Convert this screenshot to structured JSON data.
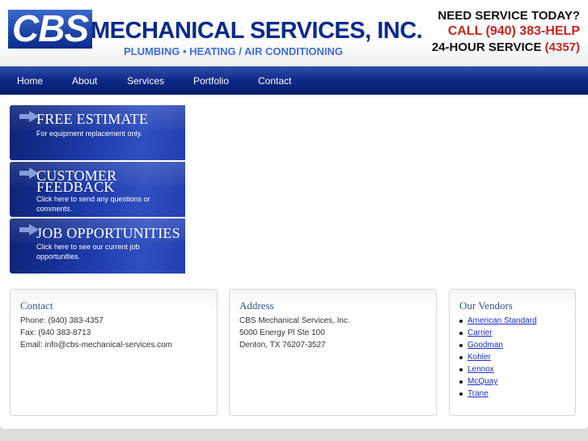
{
  "header": {
    "logo_cbs": "CBS",
    "logo_name": "MECHANICAL SERVICES, INC.",
    "tagline": "PLUMBING • HEATING / AIR CONDITIONING",
    "service_line1": "NEED SERVICE TODAY?",
    "service_line2": "CALL (940) 383-HELP",
    "service_line3": "24-HOUR SERVICE",
    "service_line3_number": "(4357)"
  },
  "nav": {
    "items": [
      {
        "label": "Home"
      },
      {
        "label": "About"
      },
      {
        "label": "Services"
      },
      {
        "label": "Portfolio"
      },
      {
        "label": "Contact"
      }
    ]
  },
  "promos": [
    {
      "title": "FREE ESTIMATE",
      "text": "For equipment replacement only."
    },
    {
      "title": "CUSTOMER FEEDBACK",
      "text": "Click here to send any questions or comments."
    },
    {
      "title": "JOB OPPORTUNITIES",
      "text": "Click here to see our current job opportunities."
    }
  ],
  "contact": {
    "title": "Contact",
    "phone": "Phone: (940) 383-4357",
    "fax": "Fax: (940 383-8713",
    "email": "Email: info@cbs-mechanical-services.com"
  },
  "address": {
    "title": "Address",
    "line1": "CBS Mechanical Services, Inc.",
    "line2": "5000 Energy Pl Ste 100",
    "line3": "Denton, TX 76207-3527"
  },
  "vendors": {
    "title": "Our Vendors",
    "items": [
      "American Standard",
      "Carrier",
      "Goodman",
      "Kohler",
      "Lennox",
      "McQuay",
      "Trane"
    ]
  },
  "colors": {
    "brand_blue": "#0a2a8a",
    "accent_red": "#c8261d",
    "link_blue": "#1a2ec4"
  }
}
